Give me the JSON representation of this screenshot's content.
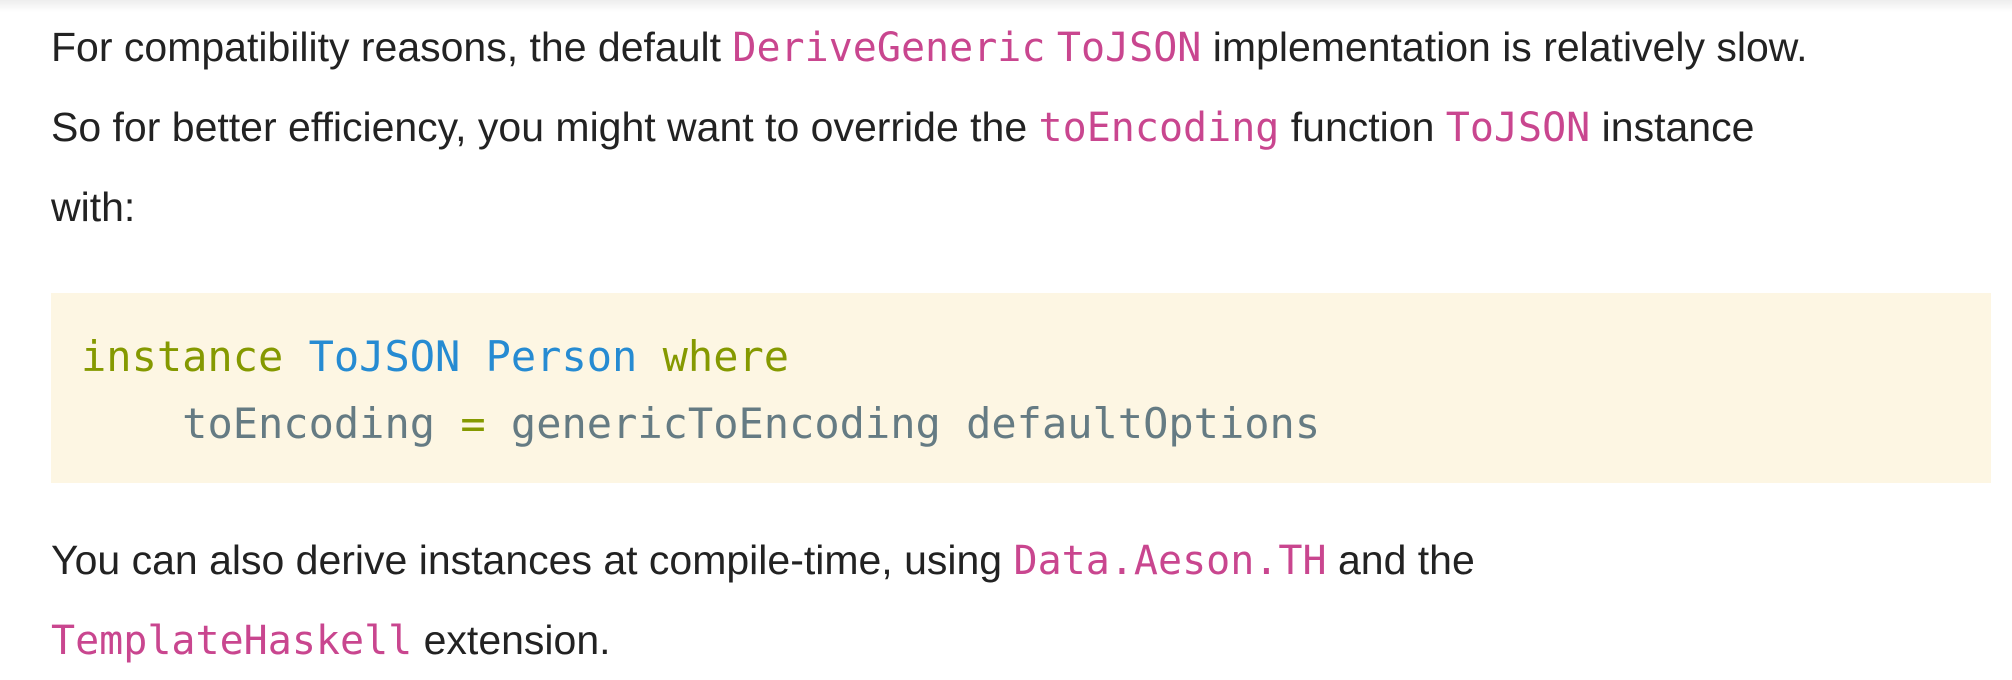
{
  "paragraph1": {
    "line1": {
      "t1": "For compatibility reasons, the default ",
      "c1": "DeriveGeneric",
      "t2": " ",
      "c2": "ToJSON",
      "t3": " implementation is relatively slow."
    },
    "line2": {
      "t1": "So for better efficiency, you might want to override the ",
      "c1": "toEncoding",
      "t2": " function ",
      "c2": "ToJSON",
      "t3": " instance"
    },
    "line3": {
      "t1": "with:"
    }
  },
  "code_block": {
    "line1": {
      "kw1": "instance",
      "sp1": " ",
      "type1": "ToJSON",
      "sp2": " ",
      "type2": "Person",
      "sp3": " ",
      "kw2": "where"
    },
    "line2": {
      "indent": "    ",
      "id1": "toEncoding",
      "sp1": " ",
      "op": "=",
      "sp2": " ",
      "id2": "genericToEncoding",
      "sp3": " ",
      "id3": "defaultOptions"
    }
  },
  "paragraph2": {
    "line1": {
      "t1": "You can also derive instances at compile-time, using ",
      "c1": "Data.Aeson.TH",
      "t2": " and the"
    },
    "line2": {
      "c1": "TemplateHaskell",
      "t1": " extension."
    }
  },
  "colors": {
    "inline_code": "#c9468f",
    "code_bg": "#fdf6e3",
    "keyword": "#859900",
    "type": "#268bd2",
    "identifier": "#657b83"
  }
}
